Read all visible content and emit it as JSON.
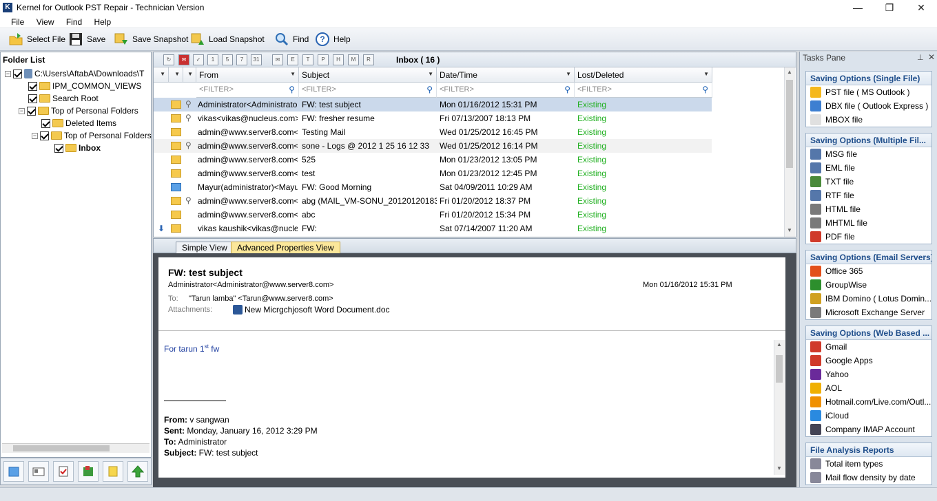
{
  "window": {
    "title": "Kernel for Outlook PST Repair - Technician Version",
    "app_icon": "K",
    "controls": [
      "—",
      "❐",
      "✕"
    ]
  },
  "menu": [
    "File",
    "View",
    "Find",
    "Help"
  ],
  "toolbar": {
    "select_file": "Select File",
    "save": "Save",
    "save_snapshot": "Save Snapshot",
    "load_snapshot": "Load Snapshot",
    "find": "Find",
    "help": "Help"
  },
  "folder_list": {
    "title": "Folder List",
    "items": [
      {
        "label": "C:\\Users\\AftabA\\Downloads\\T",
        "level": 0
      },
      {
        "label": "IPM_COMMON_VIEWS",
        "level": 1
      },
      {
        "label": "Search Root",
        "level": 1
      },
      {
        "label": "Top of Personal Folders",
        "level": 1
      },
      {
        "label": "Deleted Items",
        "level": 2
      },
      {
        "label": "Top of Personal Folders",
        "level": 2
      },
      {
        "label": "Inbox",
        "level": 3
      }
    ]
  },
  "list": {
    "folder_label": "Inbox ( 16 )",
    "columns": [
      "From",
      "Subject",
      "Date/Time",
      "Lost/Deleted"
    ],
    "filter_placeholder": "<FILTER>",
    "rows": [
      {
        "from": "Administrator<Administrator...",
        "subject": "FW: test subject",
        "date": "Mon 01/16/2012 15:31 PM",
        "status": "Existing",
        "attach": true,
        "icon": "envelope-open"
      },
      {
        "from": "vikas<vikas@nucleus.com>",
        "subject": "FW: fresher resume",
        "date": "Fri 07/13/2007 18:13 PM",
        "status": "Existing",
        "attach": true,
        "icon": "envelope"
      },
      {
        "from": "admin@www.server8.com<...",
        "subject": "Testing Mail",
        "date": "Wed 01/25/2012 16:45 PM",
        "status": "Existing",
        "attach": false,
        "icon": "envelope"
      },
      {
        "from": "admin@www.server8.com<...",
        "subject": "sone - Logs @ 2012 1 25 16 12 33",
        "date": "Wed 01/25/2012 16:14 PM",
        "status": "Existing",
        "attach": true,
        "icon": "envelope"
      },
      {
        "from": "admin@www.server8.com<...",
        "subject": "525",
        "date": "Mon 01/23/2012 13:05 PM",
        "status": "Existing",
        "attach": false,
        "icon": "envelope"
      },
      {
        "from": "admin@www.server8.com<...",
        "subject": "test",
        "date": "Mon 01/23/2012 12:45 PM",
        "status": "Existing",
        "attach": false,
        "icon": "envelope"
      },
      {
        "from": "Mayur(administrator)<Mayur(...",
        "subject": "FW: Good Morning",
        "date": "Sat 04/09/2011 10:29 AM",
        "status": "Existing",
        "attach": false,
        "icon": "calendar"
      },
      {
        "from": "admin@www.server8.com<...",
        "subject": "abg (MAIL_VM-SONU_201201201837...",
        "date": "Fri 01/20/2012 18:37 PM",
        "status": "Existing",
        "attach": true,
        "icon": "envelope"
      },
      {
        "from": "admin@www.server8.com<...",
        "subject": "abc",
        "date": "Fri 01/20/2012 15:34 PM",
        "status": "Existing",
        "attach": false,
        "icon": "envelope"
      },
      {
        "from": "vikas kaushik<vikas@nucle...",
        "subject": "FW:",
        "date": "Sat 07/14/2007 11:20 AM",
        "status": "Existing",
        "attach": false,
        "icon": "envelope"
      }
    ]
  },
  "tabs": [
    "Simple View",
    "Advanced Properties View"
  ],
  "preview": {
    "subject": "FW: test subject",
    "sender": "Administrator<Administrator@www.server8.com>",
    "date": "Mon 01/16/2012 15:31 PM",
    "to_label": "To:",
    "to": "\"Tarun lamba\" <Tarun@www.server8.com>",
    "attachments_label": "Attachments:",
    "attachment": "New Micrgchjosoft Word Document.doc",
    "body_line": "For tarun 1",
    "body_sup": "st",
    "body_tail": " fw",
    "from_label": "From:",
    "from_value": " v sangwan",
    "sent_label": "Sent:",
    "sent_value": " Monday, January 16, 2012 3:29 PM",
    "to2_label": "To:",
    "to2_value": " Administrator",
    "subject_label": "Subject:",
    "subject_value": " FW: test subject"
  },
  "tasks": {
    "title": "Tasks Pane",
    "groups": [
      {
        "title": "Saving Options (Single File)",
        "items": [
          "PST file ( MS Outlook )",
          "DBX file ( Outlook Express )",
          "MBOX file"
        ]
      },
      {
        "title": "Saving Options (Multiple Fil...",
        "items": [
          "MSG file",
          "EML file",
          "TXT file",
          "RTF file",
          "HTML file",
          "MHTML file",
          "PDF file"
        ]
      },
      {
        "title": "Saving Options (Email Servers)",
        "items": [
          "Office 365",
          "GroupWise",
          "IBM Domino ( Lotus Domin...",
          "Microsoft Exchange Server"
        ]
      },
      {
        "title": "Saving Options (Web Based ...",
        "items": [
          "Gmail",
          "Google Apps",
          "Yahoo",
          "AOL",
          "Hotmail.com/Live.com/Outl...",
          "iCloud",
          "Company IMAP Account"
        ]
      },
      {
        "title": "File Analysis Reports",
        "items": [
          "Total item types",
          "Mail flow density by date"
        ]
      }
    ]
  },
  "colors": {
    "accent": "#1f4e8b",
    "existing": "#22b022",
    "selected_row": "#cbd9eb",
    "active_tab": "#fbe79a"
  }
}
